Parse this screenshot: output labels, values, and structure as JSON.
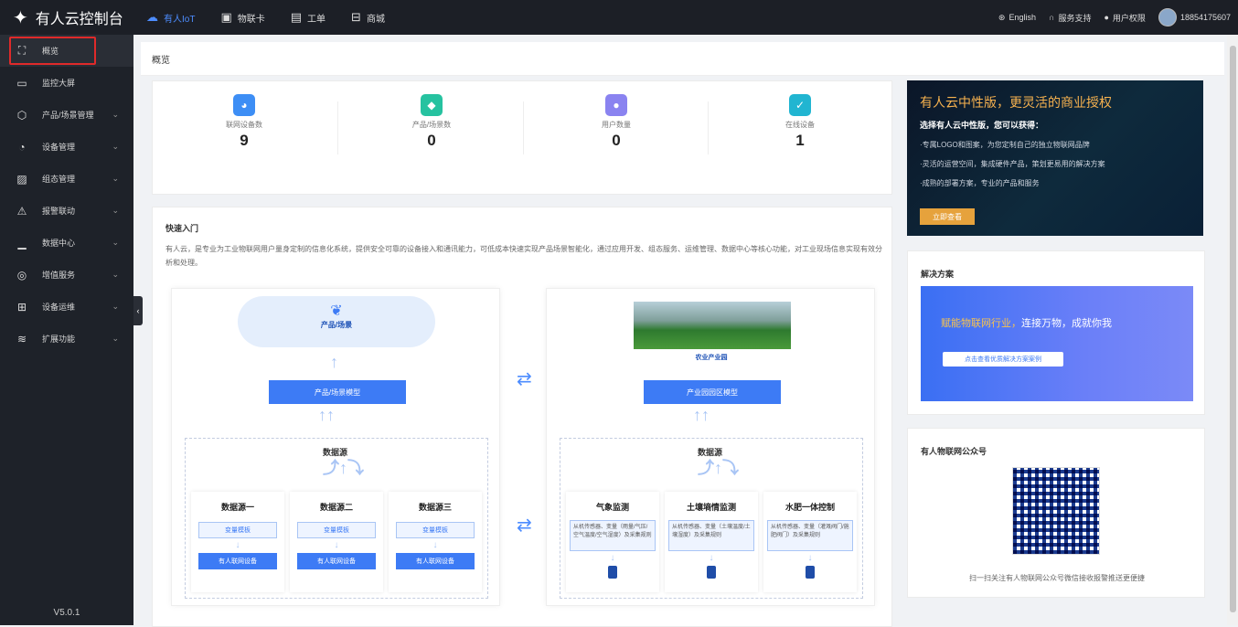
{
  "brand": {
    "name": "有人云控制台"
  },
  "topnav": [
    {
      "label": "有人IoT",
      "icon": "cloud-icon"
    },
    {
      "label": "物联卡",
      "icon": "sim-card-icon"
    },
    {
      "label": "工单",
      "icon": "ticket-icon"
    },
    {
      "label": "商城",
      "icon": "shop-icon"
    }
  ],
  "topright": {
    "language": "English",
    "support": "服务支持",
    "permission": "用户权限",
    "user": "18854175607"
  },
  "sidebar": {
    "items": [
      {
        "label": "概览",
        "icon": "overview-icon",
        "active": true
      },
      {
        "label": "监控大屏",
        "icon": "monitor-icon"
      },
      {
        "label": "产品/场景管理",
        "icon": "cube-icon",
        "expandable": true
      },
      {
        "label": "设备管理",
        "icon": "device-icon",
        "expandable": true
      },
      {
        "label": "组态管理",
        "icon": "picture-icon",
        "expandable": true
      },
      {
        "label": "报警联动",
        "icon": "alarm-icon",
        "expandable": true
      },
      {
        "label": "数据中心",
        "icon": "chart-icon",
        "expandable": true
      },
      {
        "label": "增值服务",
        "icon": "value-icon",
        "expandable": true
      },
      {
        "label": "设备运维",
        "icon": "maintenance-icon",
        "expandable": true
      },
      {
        "label": "扩展功能",
        "icon": "layers-icon",
        "expandable": true
      }
    ],
    "version": "V5.0.1"
  },
  "page": {
    "title": "概览"
  },
  "stats": [
    {
      "label": "联网设备数",
      "value": "9",
      "color": "#3d8ef5"
    },
    {
      "label": "产品/场景数",
      "value": "0",
      "color": "#26c2a0"
    },
    {
      "label": "用户数量",
      "value": "0",
      "color": "#8a83f0"
    },
    {
      "label": "在线设备",
      "value": "1",
      "color": "#21b5d1"
    }
  ],
  "quick": {
    "title": "快速入门",
    "desc": "有人云，是专业为工业物联网用户量身定制的信息化系统，提供安全可靠的设备接入和通讯能力，可低成本快速实现产品场景智能化，通过应用开发、组态服务、运维管理、数据中心等核心功能，对工业现场信息实现有效分析和处理。"
  },
  "diagram_left": {
    "cloud": "产品/场景",
    "model": "产品/场景模型",
    "datasource": "数据源",
    "sources": [
      {
        "title": "数据源一",
        "template": "变量模板",
        "device": "有人联网设备"
      },
      {
        "title": "数据源二",
        "template": "变量模板",
        "device": "有人联网设备"
      },
      {
        "title": "数据源三",
        "template": "变量模板",
        "device": "有人联网设备"
      }
    ]
  },
  "diagram_right": {
    "caption": "农业产业园",
    "model": "产业园园区模型",
    "datasource": "数据源",
    "sources": [
      {
        "title": "气象监测",
        "detail": "从机传感器、变量（雨量/气压/空气温度/空气湿度）及采集规则"
      },
      {
        "title": "土壤墒情监测",
        "detail": "从机传感器、变量（土壤温度/土壤湿度）及采集规则"
      },
      {
        "title": "水肥一体控制",
        "detail": "从机传感器、变量（灌溉阀门/施肥阀门）及采集规则"
      }
    ]
  },
  "ad1": {
    "headline": "有人云中性版，更灵活的商业授权",
    "sub": "选择有人云中性版，您可以获得：",
    "lines": [
      "·专属LOGO和图案，为您定制自己的独立物联网品牌",
      "·灵活的运营空间，集成硬件产品，策划更易用的解决方案",
      "·成熟的部署方案，专业的产品和服务"
    ],
    "button": "立即查看"
  },
  "solution": {
    "title": "解决方案",
    "headline_a": "赋能物联网行业，",
    "headline_b": "连接万物，成就你我",
    "button": "点击查看优质解决方案案例"
  },
  "wechat": {
    "title": "有人物联网公众号",
    "caption": "扫一扫关注有人物联网公众号微信接收报警推送更便捷"
  }
}
